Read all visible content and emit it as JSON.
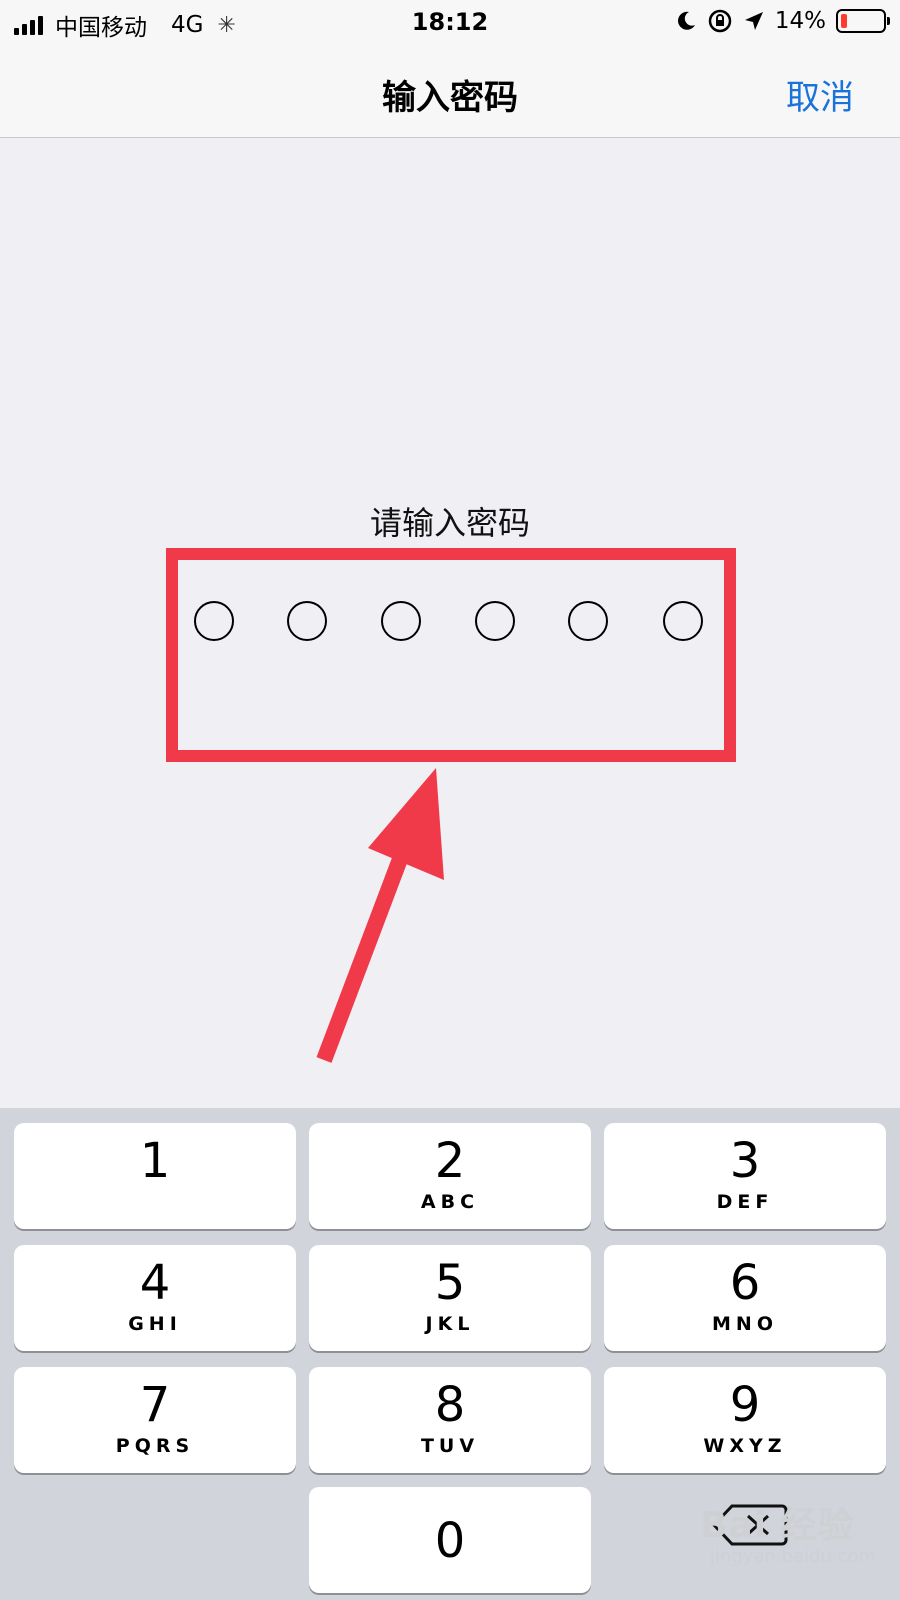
{
  "status_bar": {
    "carrier": "中国移动",
    "network": "4G",
    "time": "18:12",
    "battery": "14%",
    "battery_level": 0.14,
    "icons": [
      "signal-icon",
      "loading-spinner-icon",
      "moon-icon",
      "rotation-lock-icon",
      "location-arrow-icon",
      "battery-icon"
    ]
  },
  "nav": {
    "title": "输入密码",
    "cancel": "取消"
  },
  "prompt": "请输入密码",
  "passcode": {
    "length": 6,
    "filled": 0
  },
  "keys": [
    {
      "digit": "1",
      "letters": ""
    },
    {
      "digit": "2",
      "letters": "ABC"
    },
    {
      "digit": "3",
      "letters": "DEF"
    },
    {
      "digit": "4",
      "letters": "GHI"
    },
    {
      "digit": "5",
      "letters": "JKL"
    },
    {
      "digit": "6",
      "letters": "MNO"
    },
    {
      "digit": "7",
      "letters": "PQRS"
    },
    {
      "digit": "8",
      "letters": "TUV"
    },
    {
      "digit": "9",
      "letters": "WXYZ"
    },
    {
      "digit": "0",
      "letters": ""
    }
  ],
  "watermark": {
    "main": "Bai 经验",
    "sub": "jingyan.baidu.com"
  },
  "colors": {
    "accent": "#1a73d9",
    "highlight": "#f03a4a",
    "battery_low": "#ff3b30"
  }
}
